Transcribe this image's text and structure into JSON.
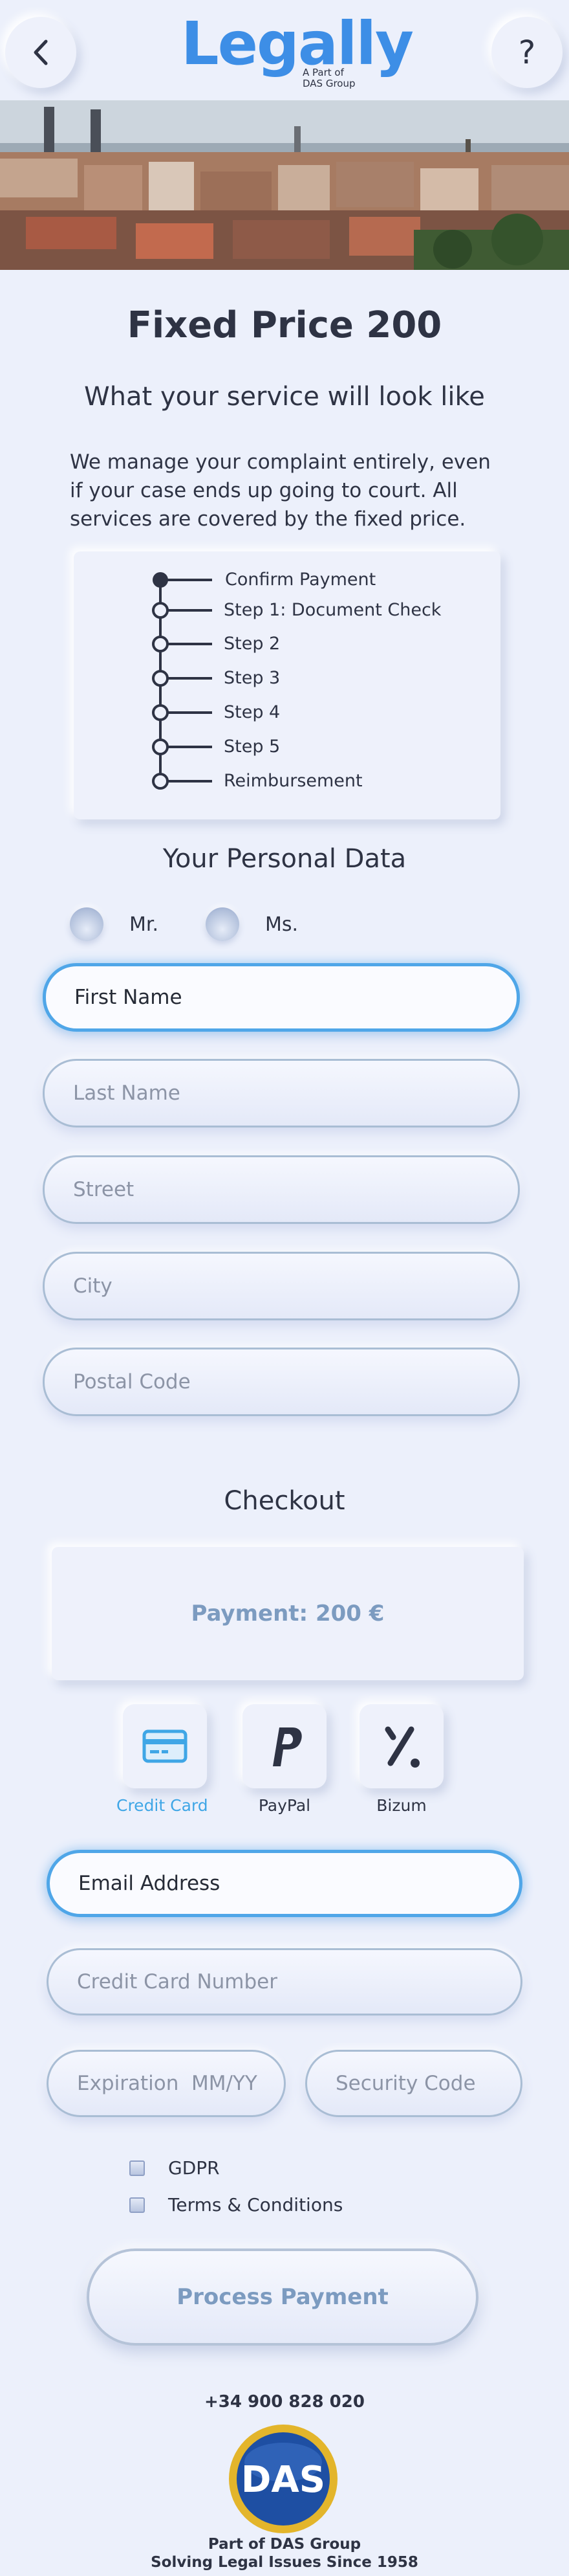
{
  "header": {
    "back_icon": "chevron-left-icon",
    "help_label": "?",
    "logo": {
      "wordmark": "Legally",
      "sub_line1": "A Part of",
      "sub_line2": "DAS Group"
    }
  },
  "hero": {
    "image_name": "city-skyline-photo"
  },
  "service": {
    "title": "Fixed Price 200",
    "subtitle": "What your service will look like",
    "description": "We manage your complaint entirely, even if your case ends up going to court. All services are covered by the fixed price."
  },
  "timeline": {
    "steps": [
      "Confirm Payment",
      "Step 1: Document Check",
      "Step 2",
      "Step 3",
      "Step 4",
      "Step 5",
      "Reimbursement"
    ]
  },
  "personal_data": {
    "heading": "Your Personal Data",
    "salutations": [
      "Mr.",
      "Ms."
    ],
    "fields": {
      "first_name": "First Name",
      "last_name": "Last Name",
      "street": "Street",
      "city": "City",
      "postal_code": "Postal Code"
    }
  },
  "checkout": {
    "heading": "Checkout",
    "payment_text": "Payment: 200 €",
    "methods": [
      {
        "label": "Credit Card",
        "icon": "credit-card-icon",
        "selected": true
      },
      {
        "label": "PayPal",
        "icon": "paypal-icon",
        "selected": false
      },
      {
        "label": "Bizum",
        "icon": "bizum-icon",
        "selected": false
      }
    ],
    "fields": {
      "email": "Email Address",
      "card_number": "Credit Card Number",
      "expiration": "Expiration  MM/YY",
      "security_code": "Security Code"
    },
    "checkboxes": [
      "GDPR",
      "Terms & Conditions"
    ],
    "process_button": "Process Payment"
  },
  "footer": {
    "phone": "+34 900 828 020",
    "badge_text": "DAS",
    "line1": "Part of DAS Group",
    "line2": "Solving Legal Issues Since 1958"
  },
  "colors": {
    "background": "#ECF0FB",
    "brand_blue": "#3D8EE6",
    "active_field_border": "#4FA6E8",
    "payment_text": "#7C9BC0",
    "credit_card_blue": "#3FA6E6",
    "das_gold": "#E3B52B",
    "das_blue": "#1E4FA3"
  }
}
